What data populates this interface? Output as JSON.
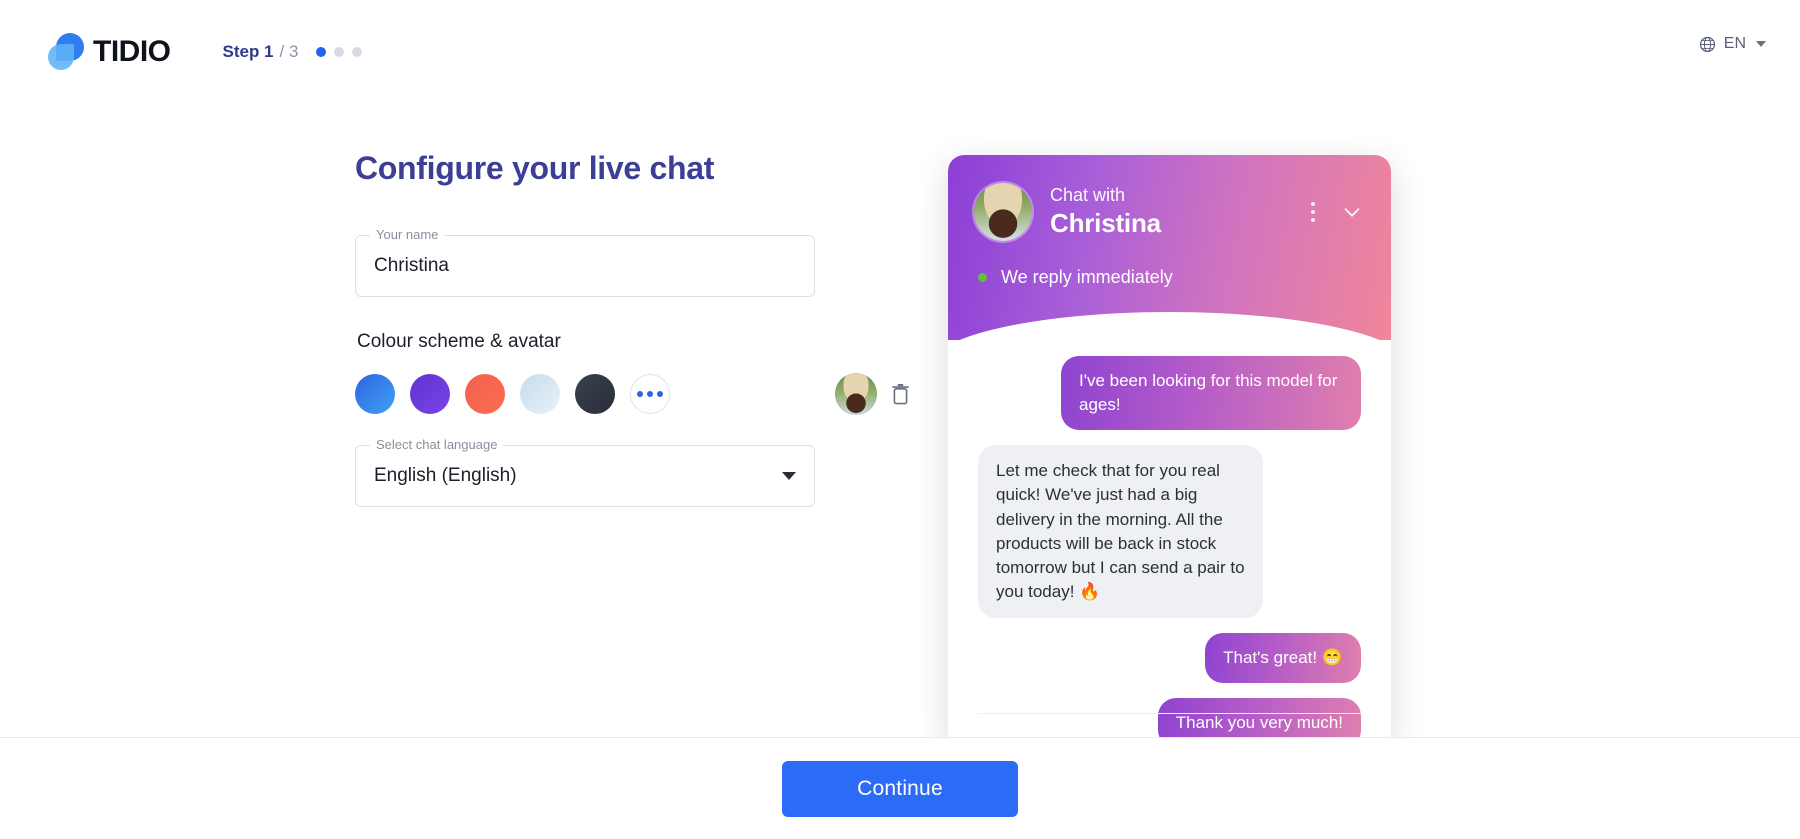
{
  "header": {
    "brand_name": "TIDIO",
    "brand_icon": "tidio-logo-icon",
    "step_label": "Step 1",
    "step_total": "/ 3",
    "step_current": 1,
    "step_count": 3,
    "language": {
      "icon": "globe-icon",
      "value": "EN",
      "caret_icon": "chevron-down-icon"
    }
  },
  "form": {
    "title": "Configure your live chat",
    "name_field": {
      "legend": "Your name",
      "value": "Christina",
      "placeholder": "Your name"
    },
    "colour_section_label": "Colour scheme & avatar",
    "swatches": [
      {
        "name": "blue",
        "from": "#2f63e0",
        "to": "#3fa2f2",
        "selected": true
      },
      {
        "name": "violet",
        "from": "#6033d0",
        "to": "#7b44e8",
        "selected": false
      },
      {
        "name": "coral",
        "from": "#f4604f",
        "to": "#fb6d52",
        "selected": false
      },
      {
        "name": "light-blue",
        "from": "#c5dcec",
        "to": "#e4eef6",
        "selected": false
      },
      {
        "name": "dark",
        "from": "#343b48",
        "to": "#2b313c",
        "selected": false
      }
    ],
    "more_colours_label": "more-colours",
    "avatar_label": "agent-avatar",
    "delete_avatar_label": "trash-icon",
    "language_field": {
      "legend": "Select chat language",
      "value": "English (English)",
      "caret_icon": "chevron-down-icon"
    }
  },
  "widget": {
    "chat_with_label": "Chat with",
    "agent_name": "Christina",
    "status_text": "We reply immediately",
    "status_color": "#61c13a",
    "header_gradient_from": "#8b3fd6",
    "header_gradient_to": "#f0869a",
    "kebab_icon": "more-options-icon",
    "minimize_icon": "chevron-down-icon",
    "messages": [
      {
        "from": "visitor",
        "text": "I've been looking for this model for ages!"
      },
      {
        "from": "agent",
        "text": "Let me check that for you real quick! We've just had a big delivery in the morning. All the products will be back in stock tomorrow but I can send a pair to you today! 🔥"
      },
      {
        "from": "visitor",
        "text": "That's great! 😁"
      },
      {
        "from": "visitor",
        "text": "Thank you very much!"
      }
    ]
  },
  "footer": {
    "continue_label": "Continue"
  }
}
